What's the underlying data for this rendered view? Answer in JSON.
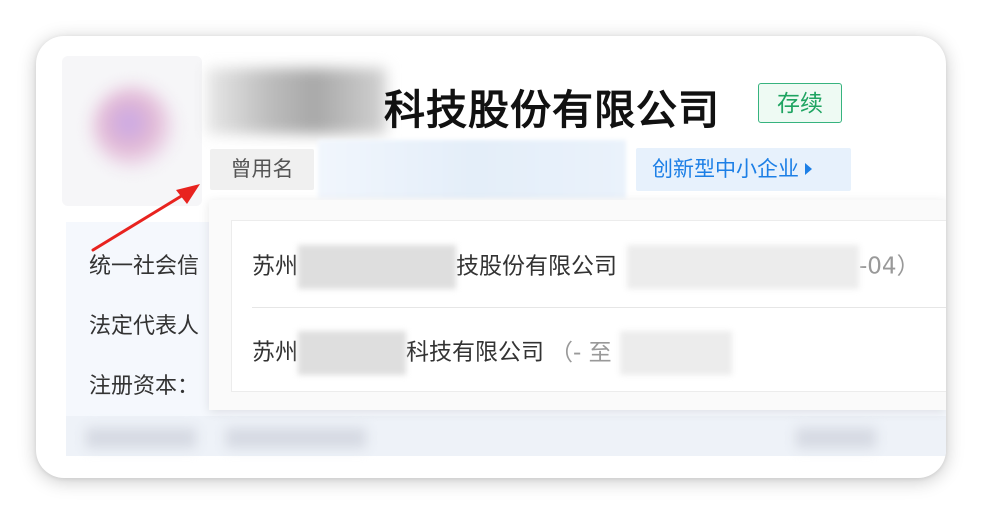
{
  "company": {
    "name_suffix": "科技股份有限公司",
    "status": "存续",
    "former_name_label": "曾用名",
    "tag_label": "创新型中小企业"
  },
  "info_labels": {
    "credit_code": "统一社会信",
    "legal_rep": "法定代表人",
    "reg_capital": "注册资本："
  },
  "former_names": [
    {
      "prefix": "苏州",
      "suffix": "技股份有限公司",
      "period_tail": "-04）"
    },
    {
      "prefix": "苏州",
      "suffix": "科技有限公司",
      "period_head": "（- 至"
    }
  ],
  "colors": {
    "status_green": "#1ea461",
    "tag_blue": "#1c7fe6",
    "annotation_red": "#e8231f"
  },
  "icons": {
    "tag_chevron": "chevron-right-icon",
    "annotation": "red-arrow-icon"
  }
}
